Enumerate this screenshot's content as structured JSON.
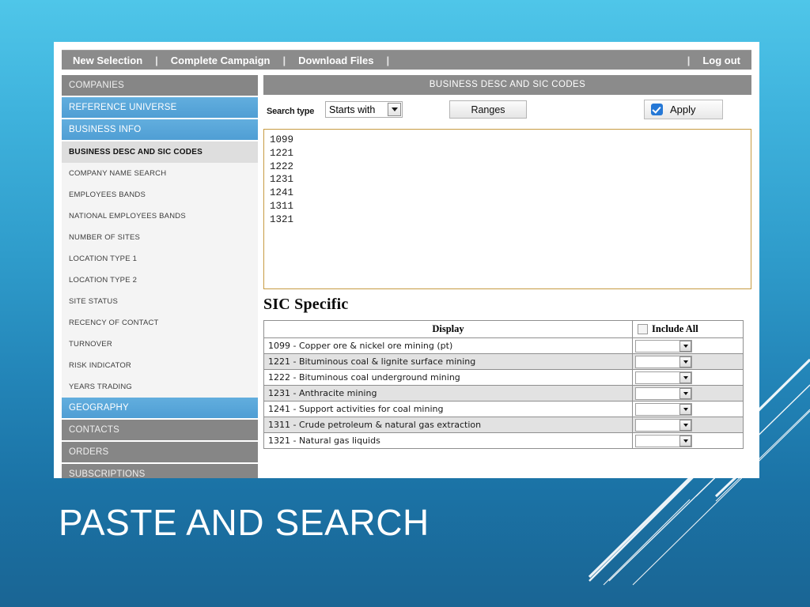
{
  "slide": {
    "headline": "PASTE AND SEARCH",
    "background_top_color": "#4fc6e9",
    "background_bottom_color": "#1a6594"
  },
  "app": {
    "topnav": {
      "items": [
        "New Selection",
        "Complete Campaign",
        "Download Files"
      ],
      "separator": "|",
      "logout": "Log out"
    },
    "sidebar": [
      {
        "label": "COMPANIES",
        "style": "grey"
      },
      {
        "label": "REFERENCE UNIVERSE",
        "style": "blue"
      },
      {
        "label": "BUSINESS INFO",
        "style": "blue"
      },
      {
        "label": "BUSINESS DESC AND SIC CODES",
        "style": "sub",
        "active": true
      },
      {
        "label": "COMPANY NAME SEARCH",
        "style": "sub"
      },
      {
        "label": "EMPLOYEES BANDS",
        "style": "sub"
      },
      {
        "label": "NATIONAL EMPLOYEES BANDS",
        "style": "sub"
      },
      {
        "label": "NUMBER OF SITES",
        "style": "sub"
      },
      {
        "label": "LOCATION TYPE 1",
        "style": "sub"
      },
      {
        "label": "LOCATION TYPE 2",
        "style": "sub"
      },
      {
        "label": "SITE STATUS",
        "style": "sub"
      },
      {
        "label": "RECENCY OF CONTACT",
        "style": "sub"
      },
      {
        "label": "TURNOVER",
        "style": "sub"
      },
      {
        "label": "RISK INDICATOR",
        "style": "sub"
      },
      {
        "label": "YEARS TRADING",
        "style": "sub"
      },
      {
        "label": "GEOGRAPHY",
        "style": "blue"
      },
      {
        "label": "CONTACTS",
        "style": "grey"
      },
      {
        "label": "ORDERS",
        "style": "grey"
      },
      {
        "label": "SUBSCRIPTIONS",
        "style": "grey"
      }
    ],
    "content": {
      "header_title": "BUSINESS DESC AND SIC CODES",
      "toolbar": {
        "search_type_label": "Search type",
        "search_type_value": "Starts with",
        "ranges_label": "Ranges",
        "apply_label": "Apply",
        "apply_checked": true,
        "accent_checkbox_color": "#2578d6"
      },
      "paste_box": {
        "border_color": "#c79b42",
        "lines": [
          "1099",
          "1221",
          "1222",
          "1231",
          "1241",
          "1311",
          "1321"
        ]
      },
      "sic_specific": {
        "heading": "SIC Specific",
        "columns": [
          "Display",
          "Include All"
        ],
        "include_all_checked": false,
        "rows": [
          {
            "display": "1099 - Copper ore & nickel ore mining (pt)",
            "value": ""
          },
          {
            "display": "1221 - Bituminous coal & lignite surface mining",
            "value": ""
          },
          {
            "display": "1222 - Bituminous coal underground mining",
            "value": ""
          },
          {
            "display": "1231 - Anthracite mining",
            "value": ""
          },
          {
            "display": "1241 - Support activities for coal mining",
            "value": ""
          },
          {
            "display": "1311 - Crude petroleum & natural gas extraction",
            "value": ""
          },
          {
            "display": "1321 - Natural gas liquids",
            "value": ""
          }
        ]
      }
    }
  }
}
